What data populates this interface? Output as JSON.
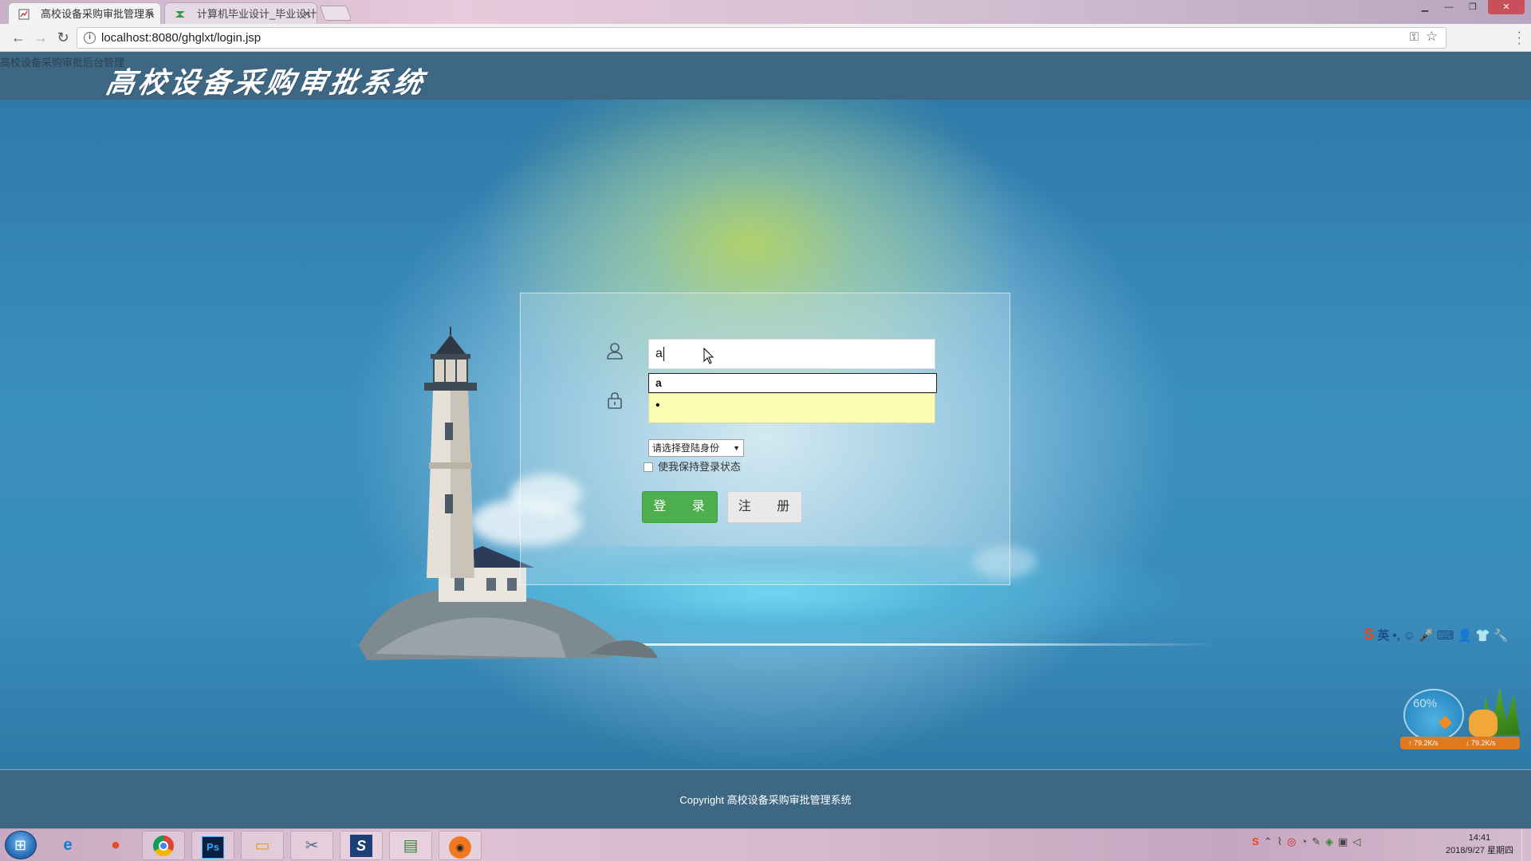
{
  "browser": {
    "tabs": [
      {
        "title": "高校设备采购审批管理系",
        "active": true
      },
      {
        "title": "计算机毕业设计_毕业设计",
        "active": false
      }
    ],
    "url": "localhost:8080/ghglxt/login.jsp",
    "close_glyph": "×"
  },
  "header": {
    "small_title": "高校设备采购审批后台管理",
    "logo_text": "高校设备采购审批系统"
  },
  "login": {
    "username_value": "a",
    "autofill_suggestion": "a",
    "password_mask": "•",
    "role_select": {
      "selected": "请选择登陆身份"
    },
    "remember_label": "使我保持登录状态",
    "login_button": "登  录",
    "register_button": "注  册"
  },
  "ime": {
    "mode": "英",
    "items": [
      "S",
      "英",
      "•,",
      "☺",
      "🎤",
      "⌨",
      "👤",
      "👕",
      "🔧"
    ]
  },
  "net_widget": {
    "percent": "60%",
    "up": "↑ 79.2K/s",
    "down": "↓ 79.2K/s"
  },
  "footer": {
    "copyright": "Copyright 高校设备采购审批管理系统"
  },
  "taskbar": {
    "clock_time": "14:41",
    "clock_date": "2018/9/27 星期四",
    "ps_label": "Ps"
  },
  "colors": {
    "header_bg": "#3d6783",
    "login_green": "#4cae4c",
    "autofill_yellow": "#fbfbb3"
  }
}
